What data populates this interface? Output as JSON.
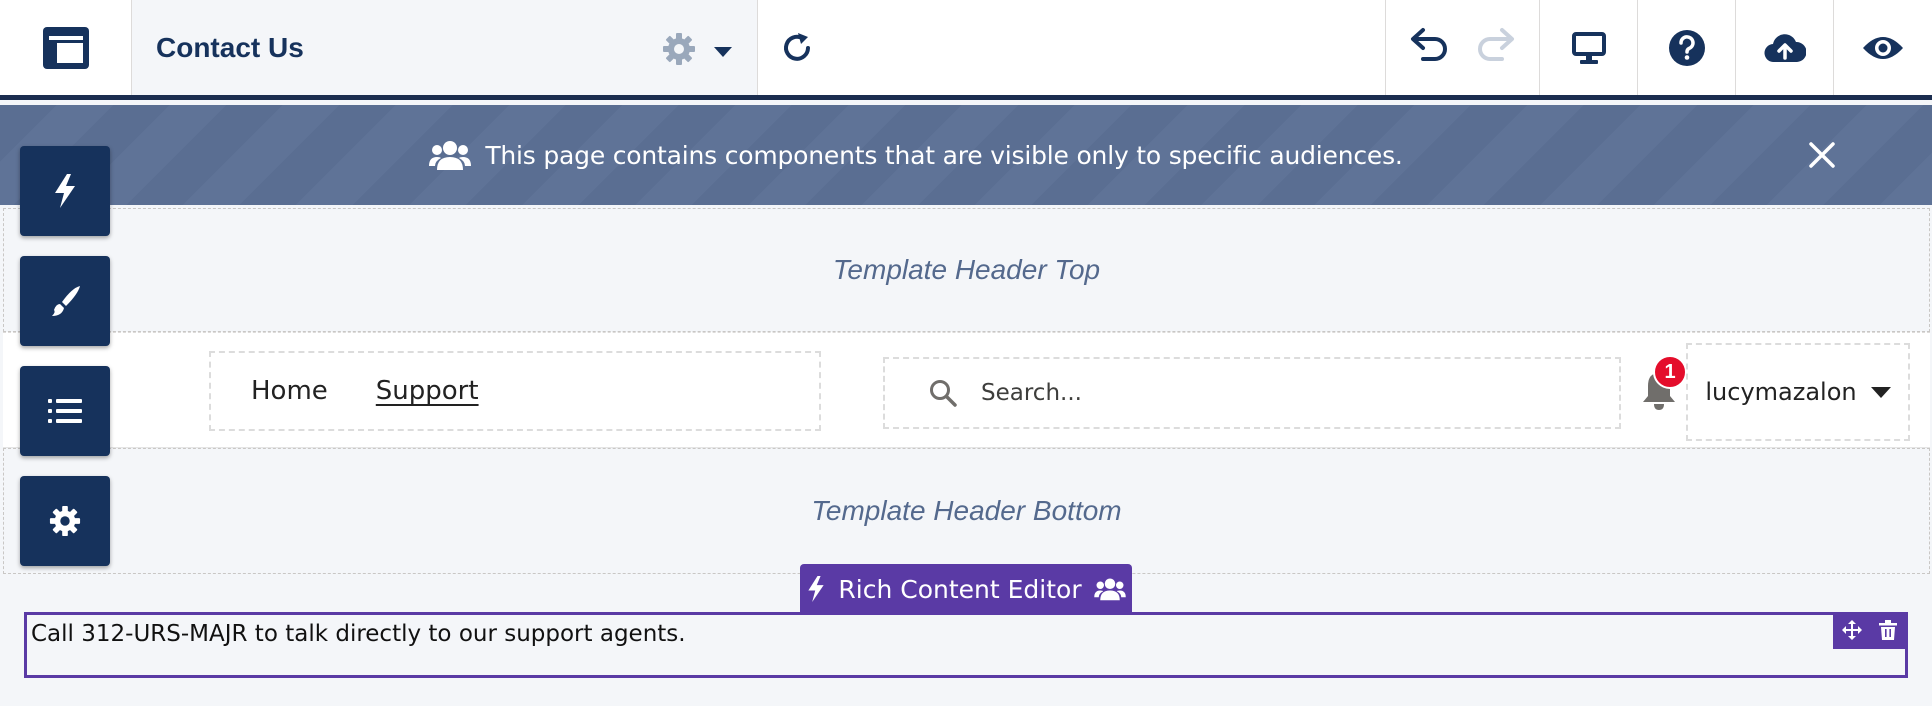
{
  "toolbar": {
    "page_title": "Contact Us",
    "icons": {
      "layout": "layout-icon",
      "page_settings": "gear-icon",
      "page_menu": "chevron-down-icon",
      "refresh": "refresh-icon",
      "undo": "undo-icon",
      "redo": "redo-icon",
      "device": "desktop-icon",
      "help": "help-icon",
      "publish": "cloud-upload-icon",
      "preview": "eye-icon"
    }
  },
  "banner": {
    "message": "This page contains components that are visible only to specific audiences.",
    "icon": "audience-icon",
    "close_icon": "close-icon"
  },
  "side_panel": {
    "items": [
      {
        "icon": "lightning-icon",
        "name": "components"
      },
      {
        "icon": "brush-icon",
        "name": "theme"
      },
      {
        "icon": "list-icon",
        "name": "page-structure"
      },
      {
        "icon": "gear-icon",
        "name": "settings"
      }
    ]
  },
  "regions": {
    "header_top": "Template Header Top",
    "header_bottom": "Template Header Bottom"
  },
  "site_header": {
    "nav": [
      {
        "label": "Home",
        "active": false
      },
      {
        "label": "Support",
        "active": true
      }
    ],
    "search": {
      "placeholder": "Search..."
    },
    "notifications": {
      "count": "1"
    },
    "user": {
      "name": "lucymazalon"
    }
  },
  "rich_content": {
    "tab_label": "Rich Content Editor",
    "text": "Call 312-URS-MAJR to talk directly to our support agents."
  },
  "colors": {
    "navy": "#16325c",
    "banner": "#5a6e92",
    "purple": "#5a3aa5",
    "badge_red": "#e40d2b"
  }
}
